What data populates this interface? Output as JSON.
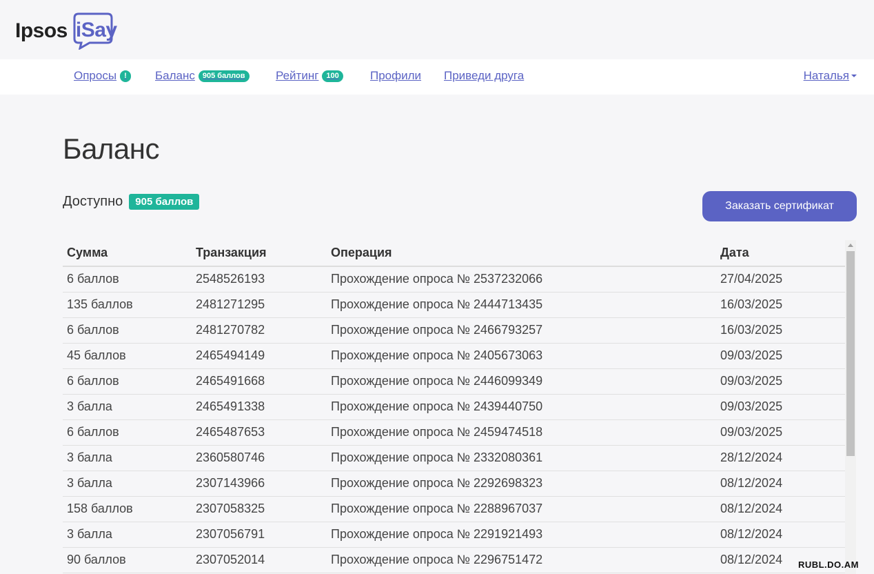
{
  "header": {
    "logo_main": "Ipsos",
    "logo_sub": "iSay"
  },
  "nav": {
    "surveys": {
      "label": "Опросы",
      "badge": "!"
    },
    "balance": {
      "label": "Баланс",
      "badge": "905 баллов"
    },
    "rating": {
      "label": "Рейтинг",
      "badge": "100"
    },
    "profiles": {
      "label": "Профили"
    },
    "invite": {
      "label": "Приведи друга"
    },
    "user": {
      "label": "Наталья"
    }
  },
  "page": {
    "title": "Баланс",
    "available_label": "Доступно",
    "available_badge": "905 баллов",
    "order_button": "Заказать сертификат"
  },
  "table": {
    "headers": [
      "Сумма",
      "Транзакция",
      "Операция",
      "Дата"
    ],
    "rows": [
      [
        "6 баллов",
        "2548526193",
        "Прохождение опроса № 2537232066",
        "27/04/2025"
      ],
      [
        "135 баллов",
        "2481271295",
        "Прохождение опроса № 2444713435",
        "16/03/2025"
      ],
      [
        "6 баллов",
        "2481270782",
        "Прохождение опроса № 2466793257",
        "16/03/2025"
      ],
      [
        "45 баллов",
        "2465494149",
        "Прохождение опроса № 2405673063",
        "09/03/2025"
      ],
      [
        "6 баллов",
        "2465491668",
        "Прохождение опроса № 2446099349",
        "09/03/2025"
      ],
      [
        "3 балла",
        "2465491338",
        "Прохождение опроса № 2439440750",
        "09/03/2025"
      ],
      [
        "6 баллов",
        "2465487653",
        "Прохождение опроса № 2459474518",
        "09/03/2025"
      ],
      [
        "3 балла",
        "2360580746",
        "Прохождение опроса № 2332080361",
        "28/12/2024"
      ],
      [
        "3 балла",
        "2307143966",
        "Прохождение опроса № 2292698323",
        "08/12/2024"
      ],
      [
        "158 баллов",
        "2307058325",
        "Прохождение опроса № 2288967037",
        "08/12/2024"
      ],
      [
        "3 балла",
        "2307056791",
        "Прохождение опроса № 2291921493",
        "08/12/2024"
      ],
      [
        "90 баллов",
        "2307052014",
        "Прохождение опроса № 2296751472",
        "08/12/2024"
      ]
    ]
  },
  "watermark": "RUBL.DO.AM",
  "colors": {
    "accent": "#5b63c4",
    "badge": "#1fb59a",
    "background": "#f6f6f8"
  }
}
